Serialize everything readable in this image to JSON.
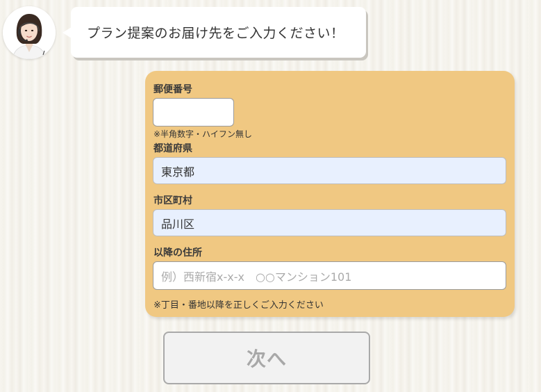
{
  "operator": {
    "avatar_icon": "operator-with-headset-icon",
    "message": "プラン提案のお届け先をご入力ください！"
  },
  "form": {
    "postal_code": {
      "label": "郵便番号",
      "value": "",
      "note": "※半角数字・ハイフン無し"
    },
    "prefecture": {
      "label": "都道府県",
      "value": "東京都"
    },
    "city": {
      "label": "市区町村",
      "value": "品川区"
    },
    "address": {
      "label": "以降の住所",
      "value": "",
      "placeholder": "例）西新宿x-x-x　○○マンション101",
      "note": "※丁目・番地以降を正しくご入力ください"
    }
  },
  "next_button": {
    "label": "次へ"
  },
  "colors": {
    "panel": "#f0c882",
    "autofill": "#e8f0fe",
    "button_disabled_text": "#a8a8a8"
  }
}
